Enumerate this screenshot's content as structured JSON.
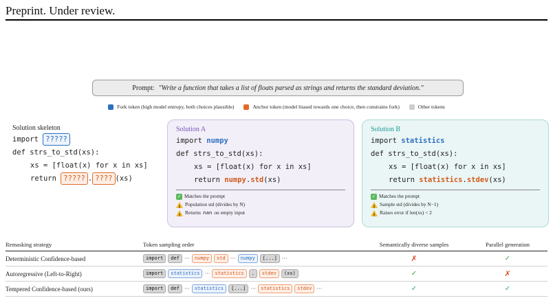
{
  "header": "Preprint. Under review.",
  "prompt": {
    "label": "Prompt:",
    "text": "\"Write a function that takes a list of floats parsed as strings and returns the standard deviation.\""
  },
  "legend": [
    {
      "label": "Fork token (high model entropy, both choices plausible)",
      "color": "#2c6fbf"
    },
    {
      "label": "Anchor token (model biased towards one choice, then constrains fork)",
      "color": "#e06a2a"
    },
    {
      "label": "Other tokens",
      "color": "#cccccc"
    }
  ],
  "skeleton": {
    "title": "Solution skeleton",
    "import_kw": "import",
    "fork_slot": "?????",
    "line2": "def strs_to_std(xs):",
    "line3": "xs = [float(x) for x in xs]",
    "return_kw": "return",
    "anchor_slot": "?????",
    "dot": ".",
    "method_slot": "????",
    "tail": "(xs)"
  },
  "solutionA": {
    "title": "Solution A",
    "import_kw": "import",
    "module": "numpy",
    "line2": "def strs_to_std(xs):",
    "line3": "xs = [float(x) for x in xs]",
    "return_kw": "return",
    "call_module": "numpy",
    "dot": ".",
    "call_fn": "std",
    "tail": "(xs)",
    "notes": [
      {
        "icon": "check-icon",
        "text": "Matches the prompt"
      },
      {
        "icon": "warning-icon",
        "text": "Population std (divides by N)"
      },
      {
        "icon": "warning-icon",
        "pre": "Returns",
        "mono": "nan",
        "post": "on empty input"
      }
    ]
  },
  "solutionB": {
    "title": "Solution B",
    "import_kw": "import",
    "module": "statistics",
    "line2": "def strs_to_std(xs):",
    "line3": "xs = [float(x) for x in xs]",
    "return_kw": "return",
    "call_module": "statistics",
    "dot": ".",
    "call_fn": "stdev",
    "tail": "(xs)",
    "notes": [
      {
        "icon": "check-icon",
        "text": "Matches the prompt"
      },
      {
        "icon": "warning-icon",
        "text": "Sample std (divides by N−1)"
      },
      {
        "icon": "warning-icon",
        "text": "Raises error if len(xs) < 2"
      }
    ]
  },
  "table": {
    "headers": [
      "Remasking strategy",
      "Token sampling order",
      "Semantically diverse samples",
      "Parallel generation"
    ],
    "rows": [
      {
        "strategy": "Deterministic Confidence-based",
        "tokens": [
          {
            "t": "import",
            "k": "gray"
          },
          {
            "t": "def",
            "k": "gray"
          },
          {
            "t": "···",
            "k": "dots"
          },
          {
            "t": "numpy",
            "k": "orange"
          },
          {
            "t": "std",
            "k": "orange"
          },
          {
            "t": "···",
            "k": "dots"
          },
          {
            "t": "numpy",
            "k": "blue"
          },
          {
            "t": "[...]",
            "k": "gray"
          },
          {
            "t": "···",
            "k": "dots"
          }
        ],
        "diverse": "✗",
        "parallel": "✓"
      },
      {
        "strategy": "Autoregressive (Left-to-Right)",
        "tokens": [
          {
            "t": "import",
            "k": "gray"
          },
          {
            "t": "statistics",
            "k": "blue"
          },
          {
            "t": "···",
            "k": "dots"
          },
          {
            "t": "statistics",
            "k": "orange"
          },
          {
            "t": ".",
            "k": "gray"
          },
          {
            "t": "stdev",
            "k": "orange"
          },
          {
            "t": "(xs)",
            "k": "gray"
          }
        ],
        "diverse": "✓",
        "parallel": "✗"
      },
      {
        "strategy": "Tempered Confidence-based (ours)",
        "tokens": [
          {
            "t": "import",
            "k": "gray"
          },
          {
            "t": "def",
            "k": "gray"
          },
          {
            "t": "···",
            "k": "dots"
          },
          {
            "t": "statistics",
            "k": "blue"
          },
          {
            "t": "[...]",
            "k": "gray"
          },
          {
            "t": "···",
            "k": "dots"
          },
          {
            "t": "statistics",
            "k": "orange"
          },
          {
            "t": "stdev",
            "k": "orange"
          },
          {
            "t": "···",
            "k": "dots"
          }
        ],
        "diverse": "✓",
        "parallel": "✓"
      }
    ]
  }
}
